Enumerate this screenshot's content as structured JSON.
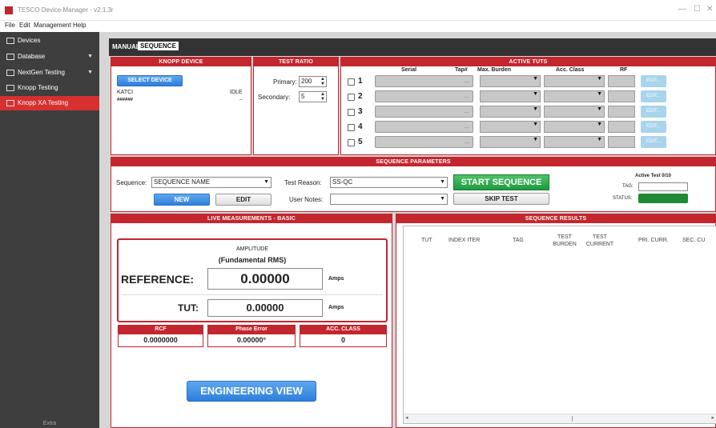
{
  "window": {
    "title": "TESCO Device Manager - v2.1.3r",
    "minimize": "—",
    "maximize": "☐",
    "close": "✕"
  },
  "menu": [
    "File",
    "Edit",
    "Management",
    "Help"
  ],
  "sidebar": {
    "items": [
      {
        "label": "Devices",
        "icon": "devices-icon"
      },
      {
        "label": "Database",
        "icon": "database-icon",
        "expandable": true
      },
      {
        "label": "NextGen Testing",
        "icon": "testing-icon",
        "expandable": true
      },
      {
        "label": "Knopp Testing",
        "icon": "testing-icon"
      },
      {
        "label": "Knopp XA Testing",
        "icon": "testing-icon",
        "active": true
      }
    ],
    "footer": "Extra"
  },
  "tabs": [
    "MANUAL",
    "SEQUENCE"
  ],
  "knopp_device": {
    "header": "KNOPP DEVICE",
    "select_button": "SELECT DEVICE",
    "device_name": "KATCI",
    "device_status": "IDLE",
    "device_id": "######",
    "device_extra": "--"
  },
  "test_ratio": {
    "header": "TEST RATIO",
    "primary_label": "Primary:",
    "primary_value": "200",
    "secondary_label": "Secondary:",
    "secondary_value": "5"
  },
  "active_tuts": {
    "header": "ACTIVE TUTS",
    "columns": [
      "Serial",
      "Tap#",
      "Max. Burden",
      "Acc. Class",
      "RF"
    ],
    "rows": [
      {
        "num": "1",
        "tap": "--",
        "edit": "EDIT..."
      },
      {
        "num": "2",
        "tap": "--",
        "edit": "EDIT..."
      },
      {
        "num": "3",
        "tap": "--",
        "edit": "EDIT..."
      },
      {
        "num": "4",
        "tap": "--",
        "edit": "EDIT..."
      },
      {
        "num": "5",
        "tap": "--",
        "edit": "EDIT..."
      }
    ]
  },
  "sequence_params": {
    "header": "SEQUENCE PARAMETERS",
    "sequence_label": "Sequence:",
    "sequence_value": "SEQUENCE NAME",
    "new_button": "NEW",
    "edit_button": "EDIT",
    "test_reason_label": "Test Reason:",
    "test_reason_value": "SS-QC",
    "user_notes_label": "User Notes:",
    "user_notes_value": "",
    "start_button": "START SEQUENCE",
    "skip_button": "SKIP TEST",
    "active_test_label": "Active Test 0/10",
    "tag_label": "TAG:",
    "status_label": "STATUS:",
    "status_color": "#1f8a36"
  },
  "live": {
    "header": "LIVE MEASUREMENTS - BASIC",
    "amplitude_label": "AMPLITUDE",
    "fundamental_label": "(Fundamental RMS)",
    "reference_label": "REFERENCE:",
    "reference_value": "0.00000",
    "reference_unit": "Amps",
    "tut_label": "TUT:",
    "tut_value": "0.00000",
    "tut_unit": "Amps",
    "rcf_label": "RCF",
    "rcf_value": "0.0000000",
    "phase_label": "Phase Error",
    "phase_value": "0.00000°",
    "acc_label": "ACC. CLASS",
    "acc_value": "0",
    "engineering_button": "ENGINEERING VIEW"
  },
  "results": {
    "header": "SEQUENCE RESULTS",
    "columns": [
      "TUT",
      "INDEX ITER",
      "TAG",
      "TEST BURDEN",
      "TEST CURRENT",
      "PRI. CURR.",
      "SEC. CU"
    ]
  },
  "colors": {
    "accent": "#c4262e",
    "sidebar": "#3e3e3e",
    "active_nav": "#d63030",
    "blue_button": "#2c7fdc",
    "green_button": "#1f9a3e"
  }
}
